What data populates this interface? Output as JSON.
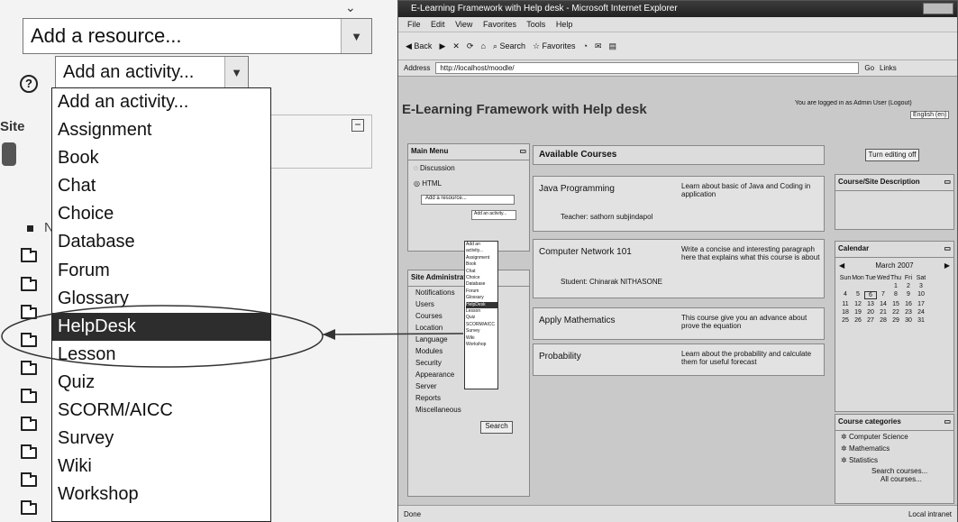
{
  "zoom": {
    "add_resource": "Add a resource...",
    "add_activity": "Add an activity...",
    "help_glyph": "?",
    "site_fragment": "Site",
    "n_fragment": "N",
    "options": [
      "Add an activity...",
      "Assignment",
      "Book",
      "Chat",
      "Choice",
      "Database",
      "Forum",
      "Glossary",
      "HelpDesk",
      "Lesson",
      "Quiz",
      "SCORM/AICC",
      "Survey",
      "Wiki",
      "Workshop"
    ],
    "highlighted": "HelpDesk"
  },
  "browser": {
    "title": "E-Learning Framework with Help desk - Microsoft Internet Explorer",
    "menus": [
      "File",
      "Edit",
      "View",
      "Favorites",
      "Tools",
      "Help"
    ],
    "back": "Back",
    "search": "Search",
    "favorites": "Favorites",
    "address_label": "Address",
    "url": "http://localhost/moodle/",
    "go": "Go",
    "links": "Links",
    "status_left": "Done",
    "status_right": "Local intranet"
  },
  "site": {
    "title": "E-Learning Framework with Help desk",
    "login": "You are logged in as Admin User (Logout)",
    "lang": "English (en)",
    "edit_button": "Turn editing off",
    "main_menu": {
      "title": "Main Menu",
      "items": [
        "Discussion",
        "HTML"
      ],
      "add_resource": "Add a resource...",
      "add_activity": "Add an activity..."
    },
    "site_admin": {
      "title": "Site Administration",
      "items": [
        "Notifications",
        "Users",
        "Courses",
        "Location",
        "Language",
        "Modules",
        "Security",
        "Appearance",
        "Server",
        "Reports",
        "Miscellaneous"
      ],
      "search": "Search"
    },
    "tiny_options": [
      "Add an activity...",
      "Assignment",
      "Book",
      "Chat",
      "Choice",
      "Database",
      "Forum",
      "Glossary",
      "HelpDesk",
      "Lesson",
      "Quiz",
      "SCORM/AICC",
      "Survey",
      "Wiki",
      "Workshop"
    ],
    "available_courses": "Available Courses",
    "courses": [
      {
        "name": "Java Programming",
        "desc": "Learn about basic of Java and Coding in application",
        "person": "Teacher: sathorn subjindapol"
      },
      {
        "name": "Computer Network 101",
        "desc": "Write a concise and interesting paragraph here that explains what this course is about",
        "person": "Student: Chinarak NITHASONE"
      },
      {
        "name": "Apply Mathematics",
        "desc": "This course give you an advance about prove the equation",
        "person": ""
      },
      {
        "name": "Probability",
        "desc": "Learn about the probability and calculate them for useful forecast",
        "person": ""
      }
    ],
    "course_desc_title": "Course/Site Description",
    "calendar": {
      "title": "Calendar",
      "month": "March 2007",
      "days": [
        "Sun",
        "Mon",
        "Tue",
        "Wed",
        "Thu",
        "Fri",
        "Sat"
      ],
      "cells": [
        "",
        "",
        "",
        "",
        "1",
        "2",
        "3",
        "4",
        "5",
        "6",
        "7",
        "8",
        "9",
        "10",
        "11",
        "12",
        "13",
        "14",
        "15",
        "16",
        "17",
        "18",
        "19",
        "20",
        "21",
        "22",
        "23",
        "24",
        "25",
        "26",
        "27",
        "28",
        "29",
        "30",
        "31"
      ],
      "today": "6"
    },
    "categories": {
      "title": "Course categories",
      "items": [
        "Computer Science",
        "Mathematics",
        "Statistics"
      ],
      "search": "Search courses...",
      "all": "All courses..."
    }
  }
}
